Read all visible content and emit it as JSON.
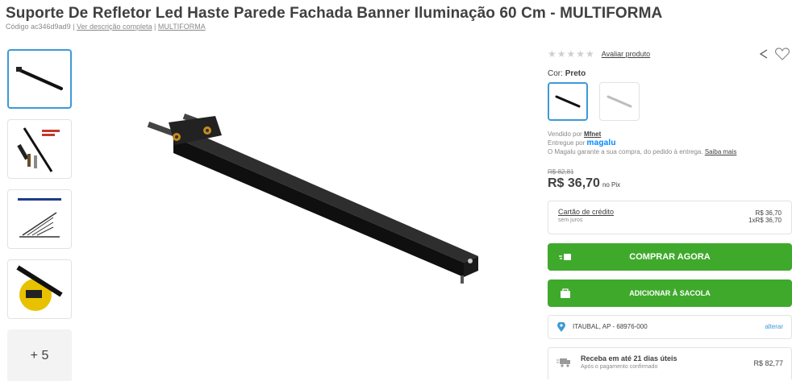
{
  "product": {
    "title": "Suporte De Refletor Led Haste Parede Fachada Banner Iluminação 60 Cm - MULTIFORMA",
    "code": "Código ac346d9ad9",
    "sep": "|",
    "full_description_link": "Ver descrição completa",
    "brand_link": "MULTIFORMA"
  },
  "gallery": {
    "more_label": "+ 5"
  },
  "rating": {
    "stars": "★★★★★",
    "rate_link": "Avaliar produto"
  },
  "color": {
    "label": "Cor:",
    "selected": "Preto"
  },
  "seller": {
    "sold_by": "Vendido por",
    "seller_name": "Mfnet",
    "delivered_by": "Entregue por",
    "delivery_brand": "magalu",
    "guarantee": "O Magalu garante a sua compra, do pedido à entrega.",
    "learn_more": "Saiba mais"
  },
  "pricing": {
    "old_price": "R$ 82,81",
    "price": "R$ 36,70",
    "pix_label": "no Pix"
  },
  "credit": {
    "title": "Cartão de crédito",
    "subtitle": "sem juros",
    "total": "R$ 36,70",
    "installment": "1xR$ 36,70"
  },
  "buttons": {
    "buy_now": "COMPRAR AGORA",
    "add_to_bag": "ADICIONAR À SACOLA"
  },
  "shipping": {
    "address": "ITAUBAL, AP - 68976-000",
    "change": "alterar"
  },
  "delivery": {
    "title": "Receba em até 21 dias úteis",
    "subtitle": "Após o pagamento confirmado",
    "price": "R$ 82,77"
  },
  "colors": {
    "accent_blue": "#3d9ad6",
    "button_green": "#3fa92c",
    "magalu_blue": "#0086ff"
  }
}
